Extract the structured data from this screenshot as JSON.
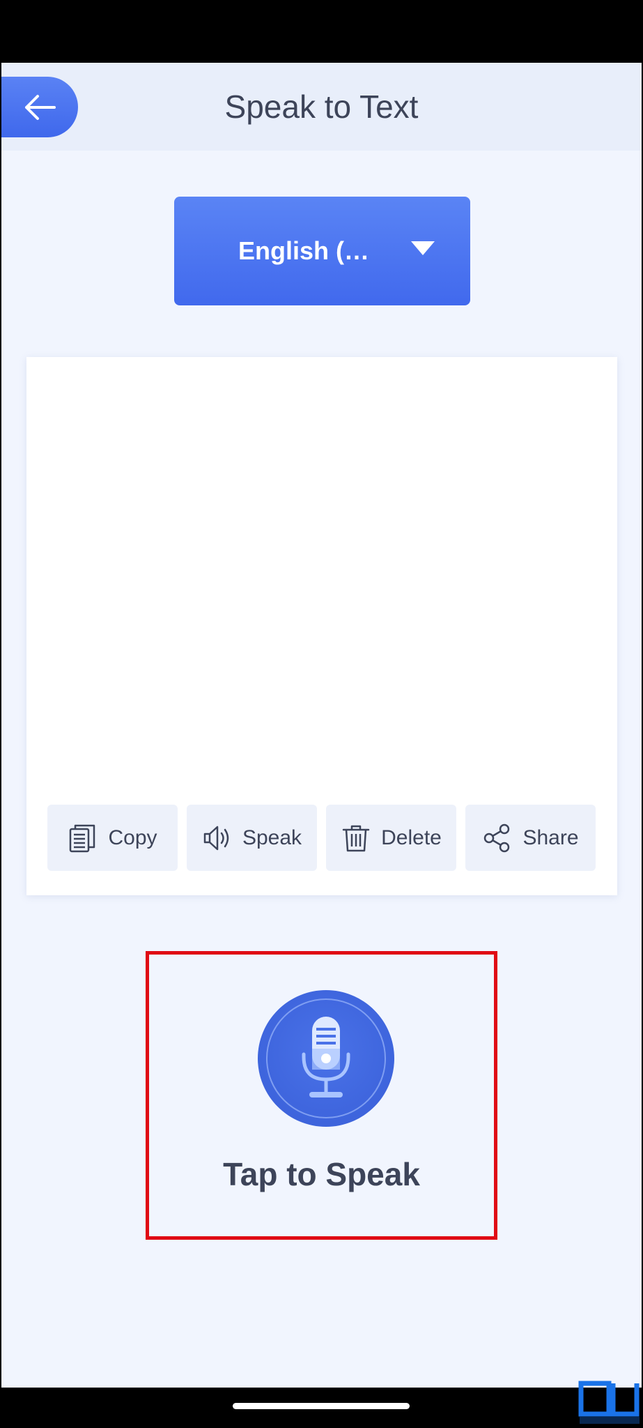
{
  "header": {
    "title": "Speak to Text"
  },
  "language": {
    "selected": "English (…"
  },
  "transcript": {
    "value": "",
    "placeholder": ""
  },
  "actions": [
    {
      "label": "Copy",
      "icon": "copy-icon"
    },
    {
      "label": "Speak",
      "icon": "speaker-icon"
    },
    {
      "label": "Delete",
      "icon": "trash-icon"
    },
    {
      "label": "Share",
      "icon": "share-icon"
    }
  ],
  "mic": {
    "label": "Tap to Speak",
    "icon": "microphone-icon"
  },
  "colors": {
    "accent": "#4169ed",
    "background": "#f1f5fe",
    "header": "#e8eefa",
    "text": "#3d4459",
    "highlight_frame": "#e00a14"
  }
}
